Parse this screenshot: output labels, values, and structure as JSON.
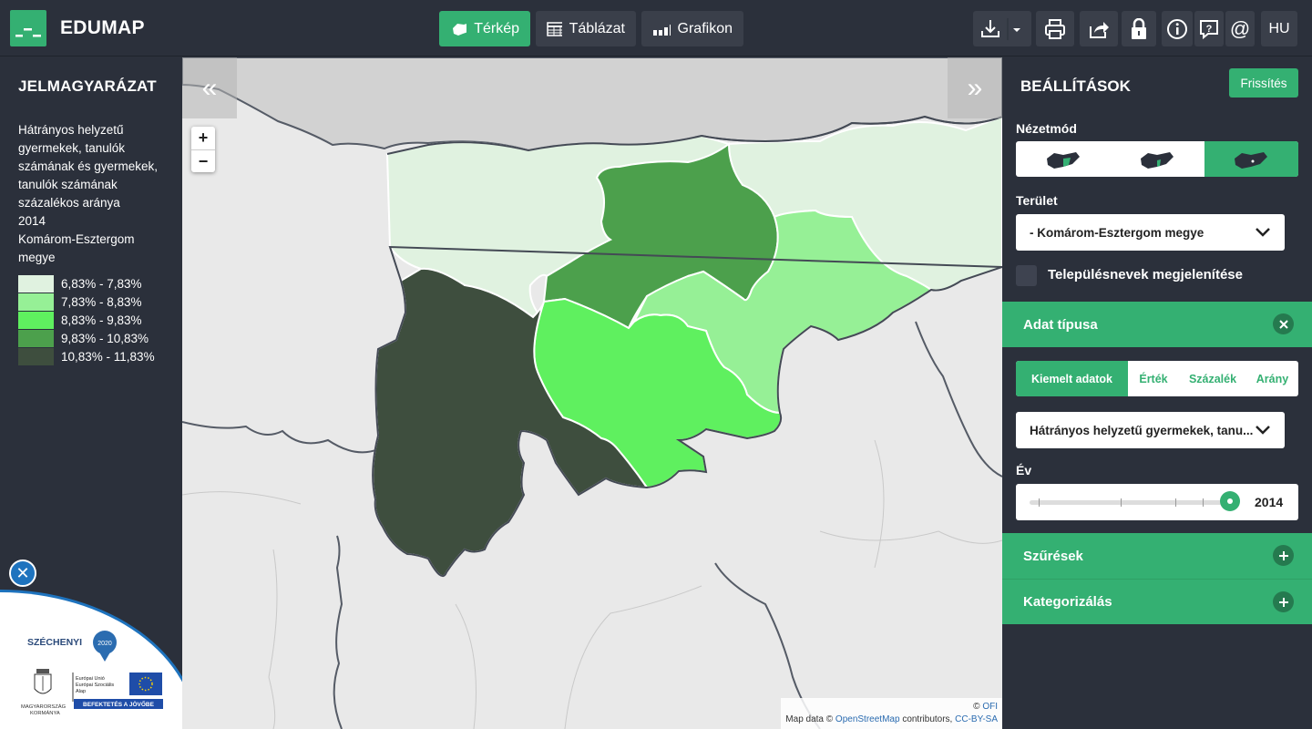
{
  "header": {
    "brand": "EDUMAP",
    "tabs": [
      {
        "label": "Térkép",
        "icon": "map-icon",
        "active": true
      },
      {
        "label": "Táblázat",
        "icon": "table-icon",
        "active": false
      },
      {
        "label": "Grafikon",
        "icon": "bar-chart-icon",
        "active": false
      }
    ],
    "lang": "HU"
  },
  "legend": {
    "title": "JELMAGYARÁZAT",
    "description_lines": [
      "Hátrányos helyzetű",
      "gyermekek, tanulók",
      "számának és gyermekek,",
      "tanulók számának",
      "százalékos aránya",
      "2014",
      "Komárom-Esztergom",
      "megye"
    ],
    "items": [
      {
        "label": "6,83% - 7,83%",
        "color": "#e0f2e0"
      },
      {
        "label": "7,83% - 8,83%",
        "color": "#96f096"
      },
      {
        "label": "8,83% - 9,83%",
        "color": "#5ff05f"
      },
      {
        "label": "9,83% - 10,83%",
        "color": "#4ca04c"
      },
      {
        "label": "10,83% - 11,83%",
        "color": "#3e4e3e"
      }
    ]
  },
  "map": {
    "attribution_prefix": "©",
    "attribution_ofi": "OFI",
    "attribution_line2_a": "Map data ©",
    "attribution_osm": "OpenStreetMap",
    "attribution_line2_b": "contributors,",
    "attribution_license": "CC-BY-SA"
  },
  "sponsor": {
    "szechenyi": "SZÉCHENYI",
    "year": "2020",
    "eu_line1": "Európai Unió",
    "eu_line2": "Európai Szociális",
    "eu_line3": "Alap",
    "gov_line1": "MAGYARORSZÁG",
    "gov_line2": "KORMÁNYA",
    "slogan": "BEFEKTETÉS A JÖVŐBE"
  },
  "panel": {
    "title": "BEÁLLÍTÁSOK",
    "refresh_label": "Frissítés",
    "viewmode_label": "Nézetmód",
    "area_label": "Terület",
    "area_value": "- Komárom-Esztergom megye",
    "show_names_label": "Településnevek megjelenítése",
    "datatype_section": "Adat típusa",
    "datatype_tabs": [
      "Kiemelt adatok",
      "Érték",
      "Százalék",
      "Arány"
    ],
    "indicator_value": "Hátrányos helyzetű gyermekek, tanu...",
    "year_label": "Év",
    "year_value": "2014",
    "filters_section": "Szűrések",
    "categorize_section": "Kategorizálás"
  }
}
